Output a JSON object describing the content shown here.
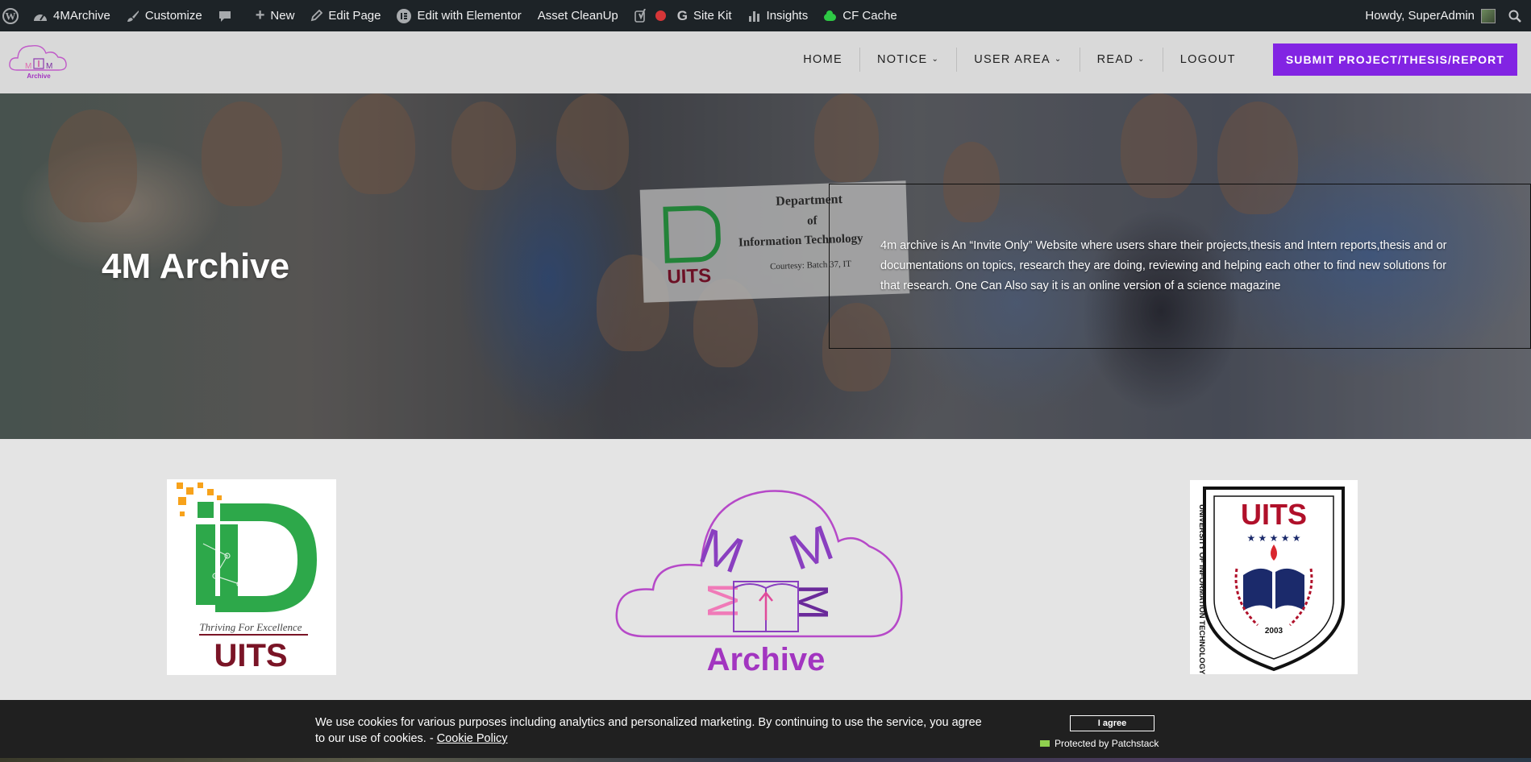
{
  "admin_bar": {
    "site_name": "4MArchive",
    "customize": "Customize",
    "new": "New",
    "edit_page": "Edit Page",
    "edit_elementor": "Edit with Elementor",
    "asset_cleanup": "Asset CleanUp",
    "site_kit": "Site Kit",
    "insights": "Insights",
    "cf_cache": "CF Cache",
    "howdy": "Howdy, SuperAdmin"
  },
  "header": {
    "logo_text": "Archive",
    "nav": [
      {
        "label": "HOME"
      },
      {
        "label": "NOTICE"
      },
      {
        "label": "USER AREA"
      },
      {
        "label": "READ"
      },
      {
        "label": "LOGOUT"
      }
    ],
    "submit_label": "SUBMIT PROJECT/THESIS/REPORT"
  },
  "hero": {
    "title": "4M Archive",
    "description": "4m archive is An “Invite Only” Website where users share their projects,thesis and Intern reports,thesis and or documentations on topics, research they are doing, reviewing and helping each other to find new solutions for that research. One Can Also say it is an online version of a science magazine",
    "sign_line1": "Department",
    "sign_line2": "of",
    "sign_line3": "Information Technology",
    "sign_line4": "Courtesy: Batch 37, IT",
    "sign_logo_text": "UITS"
  },
  "logos": {
    "itd_tagline": "Thriving For Excellence",
    "itd_bottom": "UITS",
    "archive_text": "Archive",
    "uits_top": "UITS",
    "uits_ring": "UNIVERSITY OF INFORMATION TECHNOLOGY AND SCIENCES",
    "uits_year": "2003"
  },
  "cookie": {
    "text": "We use cookies for various purposes including analytics and personalized marketing. By continuing to use the service, you agree to our use of cookies. - ",
    "link": "Cookie Policy",
    "accept": "I agree",
    "protected": "Protected by Patchstack"
  },
  "colors": {
    "admin_bar": "#1d2327",
    "accent_purple": "#8224e3",
    "itd_green": "#2da84a",
    "uits_red": "#b0102a",
    "uits_navy": "#1b2a6b",
    "archive_purple": "#a235c0"
  }
}
